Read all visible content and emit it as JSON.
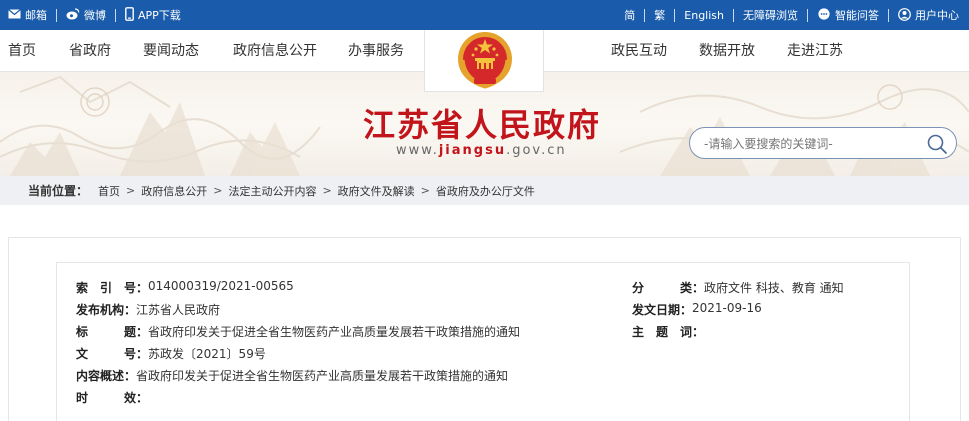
{
  "topbar": {
    "left_items": [
      {
        "icon": "mail-icon",
        "label": "邮箱"
      },
      {
        "icon": "weibo-icon",
        "label": "微博"
      },
      {
        "icon": "phone-icon",
        "label": "APP下载"
      }
    ],
    "right_items": [
      {
        "label": "简"
      },
      {
        "label": "繁"
      },
      {
        "label": "English"
      },
      {
        "label": "无障碍浏览"
      },
      {
        "icon": "chat-icon",
        "label": "智能问答"
      },
      {
        "icon": "user-icon",
        "label": "用户中心"
      }
    ]
  },
  "nav": {
    "left": [
      "首页",
      "省政府",
      "要闻动态",
      "政府信息公开",
      "办事服务"
    ],
    "right": [
      "政民互动",
      "数据开放",
      "走进江苏"
    ]
  },
  "banner": {
    "title": "江苏省人民政府",
    "url_prefix": "www.",
    "url_bold": "jiangsu",
    "url_suffix": ".gov.cn"
  },
  "search": {
    "placeholder": "-请输入要搜索的关键词-",
    "icon": "search-icon"
  },
  "breadcrumb": {
    "label": "当前位置：",
    "items": [
      "首页",
      "政府信息公开",
      "法定主动公开内容",
      "政府文件及解读",
      "省政府及办公厅文件"
    ]
  },
  "info": {
    "left": [
      {
        "key": "索　引　号：",
        "value": "014000319/2021-00565"
      },
      {
        "key": "发布机构：",
        "value": "江苏省人民政府"
      },
      {
        "key": "标　　　题：",
        "value": "省政府印发关于促进全省生物医药产业高质量发展若干政策措施的通知"
      },
      {
        "key": "文　　　号：",
        "value": "苏政发〔2021〕59号"
      },
      {
        "key": "内容概述：",
        "value": "省政府印发关于促进全省生物医药产业高质量发展若干政策措施的通知"
      },
      {
        "key": "时　　　效：",
        "value": ""
      }
    ],
    "right": [
      {
        "key": "分　　　类：",
        "value": "政府文件 科技、教育 通知"
      },
      {
        "key": "发文日期：",
        "value": "2021-09-16"
      },
      {
        "key": "主　题　词：",
        "value": ""
      }
    ]
  },
  "colors": {
    "topbar": "#1a5cab",
    "title_red": "#c2141b",
    "crumb_bg": "#eef0f3"
  }
}
